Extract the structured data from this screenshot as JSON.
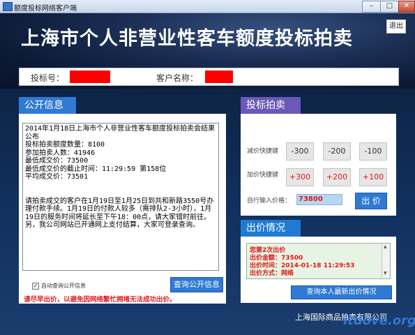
{
  "window": {
    "title": "额度投标网络客户端",
    "min_label": "–",
    "max_label": "□",
    "close_label": "✕"
  },
  "header": {
    "headline": "上海市个人非营业性客车额度投标拍卖",
    "logout_label": "退出"
  },
  "info_bar": {
    "bid_no_label": "投标号：",
    "customer_label": "客户名称："
  },
  "public_info": {
    "title": "公开信息",
    "text": "2014年1月18日上海市个人非营业性客车额度投标拍卖会结果公布\n投标拍卖额度数量：8100\n参加拍卖人数：41946\n最低成交价：73500\n最低成交价的截止时间：11:29:59 第158位\n平均成交价：73501\n\n\n请拍卖成交的客户在1月19日至1月25日到共和新路3550号办理付款手续。1月19日的付款人较多（需排队2-3小时），1月19日的服务时间将延长至下午18：00点，请大家错时前往。另，我公司网站已开通网上支付结算，大家可登录查询。",
    "auto_query_label": "自动查询公开信息",
    "auto_query_checked": true,
    "query_button": "查询公开信息",
    "warning": "请尽早出价，以避免因网络繁忙拥堵无法成功出价。"
  },
  "bidding": {
    "title": "投标拍卖",
    "decrease_label": "减价快捷键",
    "increase_label": "加价快捷键",
    "decrease_buttons": [
      "-300",
      "-200",
      "-100"
    ],
    "increase_buttons": [
      "+300",
      "+200",
      "+100"
    ],
    "custom_price_label": "自行输入价格：",
    "custom_price_value": "73800",
    "submit_label": "出 价"
  },
  "offer_status": {
    "title": "出价情况",
    "lines": [
      "您第2次出价",
      "出价金额：73500",
      "出价时间：2014-01-18 11:29:53",
      "出价方式：网络"
    ],
    "latest_button": "查询本人最新出价情况"
  },
  "footer": {
    "company": "上海国际商品拍卖有限公司",
    "watermark": "itdove.org"
  },
  "colors": {
    "panel_blue": "#2f7ad3",
    "panel_purple": "#6b58b8",
    "alert_red": "#e01818",
    "redaction": "#ff0000"
  }
}
